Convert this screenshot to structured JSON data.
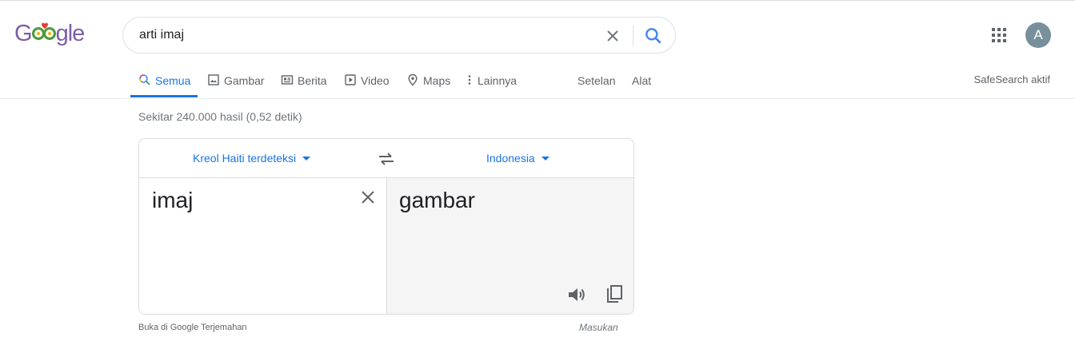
{
  "logo": {
    "text_g": "G",
    "text_rest": "gle"
  },
  "search": {
    "query": "arti imaj"
  },
  "account": {
    "avatar_letter": "A"
  },
  "tabs": [
    {
      "label": "Semua",
      "icon": "search-icon"
    },
    {
      "label": "Gambar",
      "icon": "image-icon"
    },
    {
      "label": "Berita",
      "icon": "news-icon"
    },
    {
      "label": "Video",
      "icon": "video-icon"
    },
    {
      "label": "Maps",
      "icon": "map-pin-icon"
    },
    {
      "label": "Lainnya",
      "icon": "more-vert-icon"
    }
  ],
  "tools": {
    "settings": "Setelan",
    "tools": "Alat",
    "safesearch": "SafeSearch aktif"
  },
  "stats": "Sekitar 240.000 hasil (0,52 detik)",
  "translate": {
    "source_lang": "Kreol Haiti terdeteksi",
    "target_lang": "Indonesia",
    "source_text": "imaj",
    "target_text": "gambar",
    "open_link": "Buka di Google Terjemahan",
    "feedback": "Masukan"
  },
  "colors": {
    "accent": "#1a73e8",
    "avatar_bg": "#78909c",
    "logo": "#7b5ea7"
  }
}
